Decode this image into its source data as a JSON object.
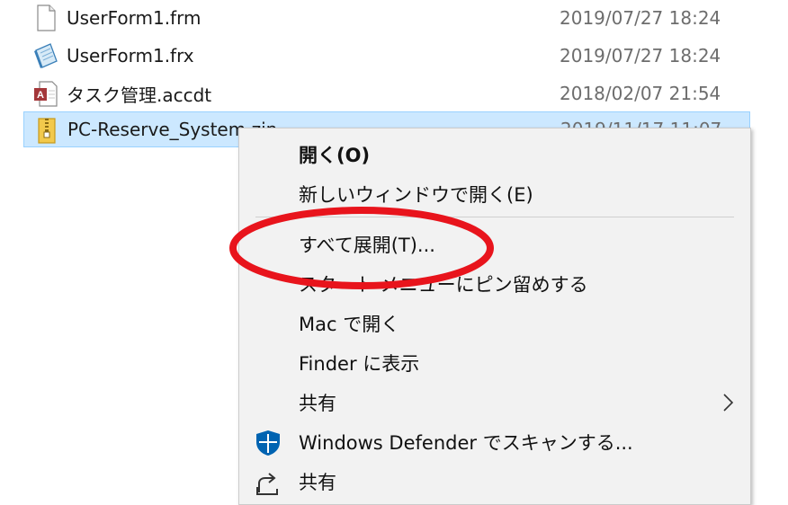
{
  "files": [
    {
      "name": "UserForm1.frm",
      "date": "2019/07/27 18:24",
      "icon": "document-icon"
    },
    {
      "name": "UserForm1.frx",
      "date": "2019/07/27 18:24",
      "icon": "notepad-file-icon"
    },
    {
      "name": "タスク管理.accdt",
      "date": "2018/02/07 21:54",
      "icon": "access-template-icon"
    },
    {
      "name": "PC-Reserve_System.zip",
      "date": "2019/11/17 11:07",
      "icon": "zip-folder-icon"
    }
  ],
  "context_menu": {
    "open": "開く(O)",
    "open_new_window": "新しいウィンドウで開く(E)",
    "extract_all": "すべて展開(T)...",
    "pin_to_start": "スタート メニューにピン留めする",
    "open_in_mac": "Mac で開く",
    "show_in_finder": "Finder に表示",
    "share": "共有",
    "defender_scan": "Windows Defender でスキャンする...",
    "share2": "共有"
  },
  "colors": {
    "selection_bg": "#cce8ff",
    "annotation": "#e8141c",
    "defender_blue": "#0063b1"
  }
}
